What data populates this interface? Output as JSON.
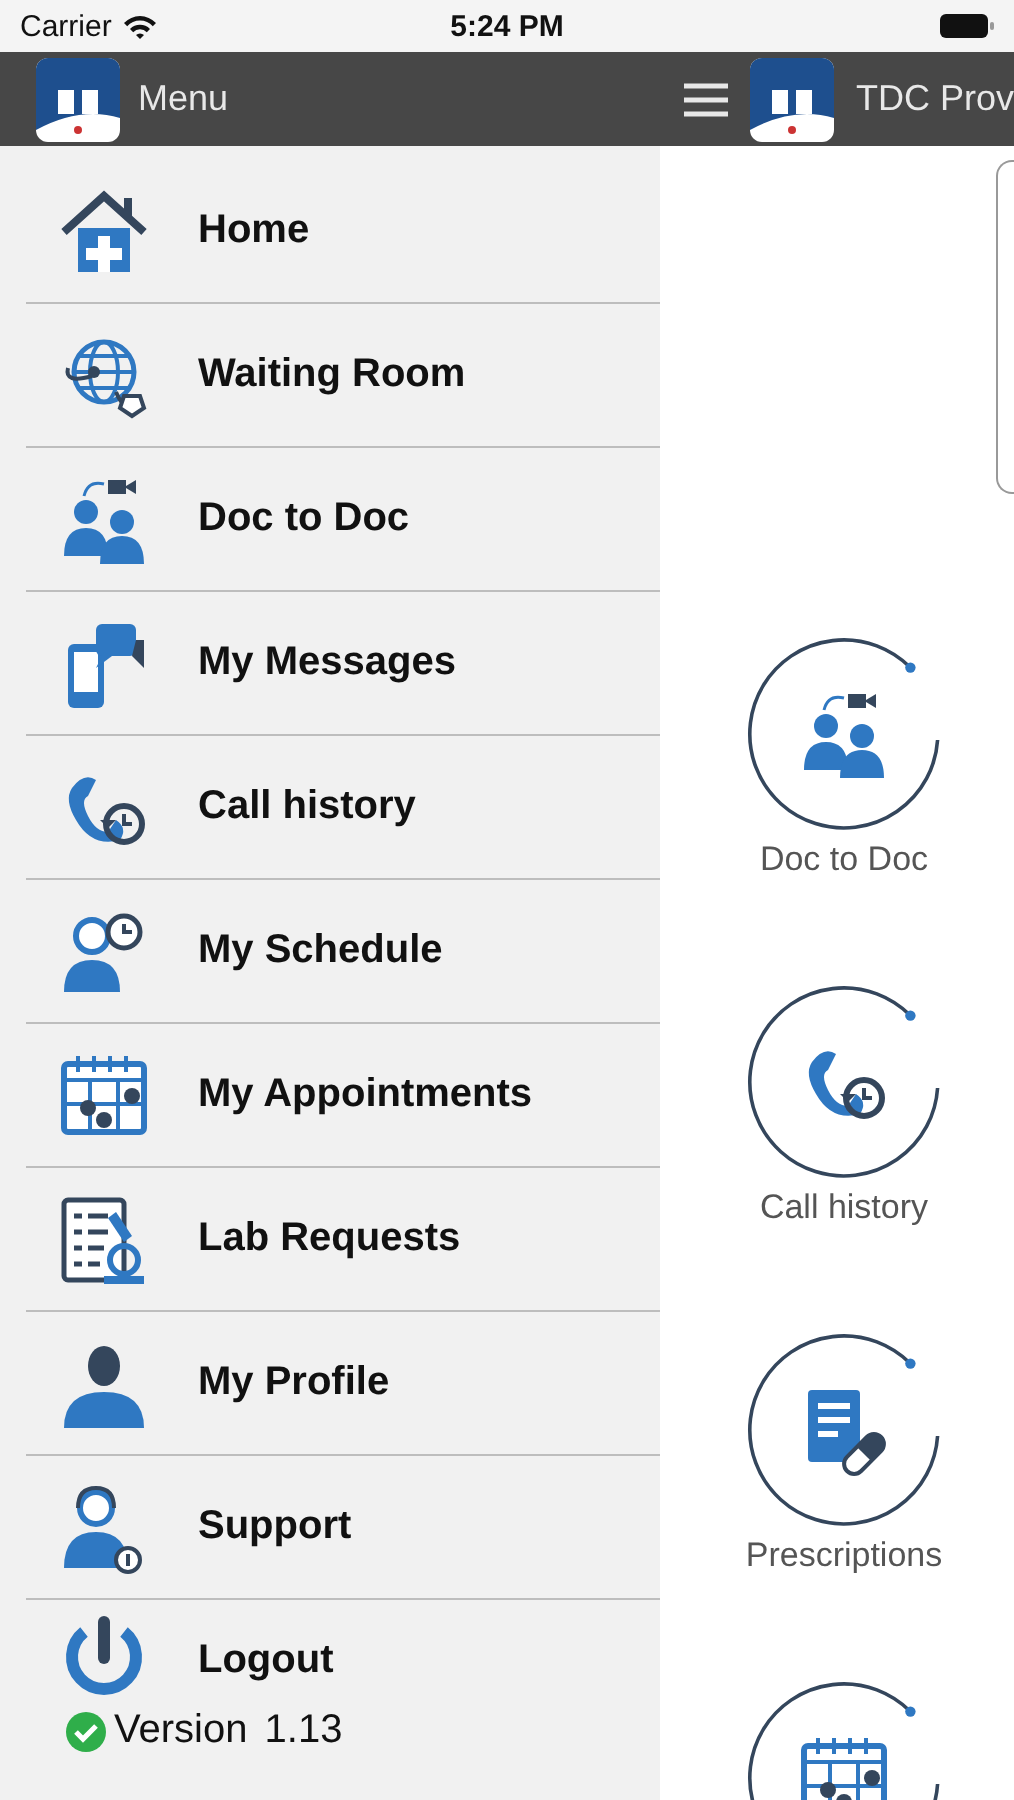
{
  "status_bar": {
    "carrier": "Carrier",
    "time": "5:24 PM"
  },
  "menu_header": {
    "title": "Menu"
  },
  "app_bar": {
    "title": "TDC Prov"
  },
  "menu_items": [
    {
      "label": "Home",
      "kind": "home"
    },
    {
      "label": "Waiting Room",
      "kind": "globe"
    },
    {
      "label": "Doc to Doc",
      "kind": "doctors"
    },
    {
      "label": "My Messages",
      "kind": "messages"
    },
    {
      "label": "Call history",
      "kind": "call"
    },
    {
      "label": "My Schedule",
      "kind": "schedule"
    },
    {
      "label": "My Appointments",
      "kind": "calendar"
    },
    {
      "label": "Lab Requests",
      "kind": "lab"
    },
    {
      "label": "My Profile",
      "kind": "profile"
    },
    {
      "label": "Support",
      "kind": "support"
    },
    {
      "label": "Logout",
      "kind": "power"
    }
  ],
  "version": {
    "label": "Version",
    "number": "1.13"
  },
  "tiles": [
    {
      "label": "Doc to Doc",
      "kind": "doctors"
    },
    {
      "label": "Call history",
      "kind": "call"
    },
    {
      "label": "Prescriptions",
      "kind": "prescription"
    },
    {
      "kind": "calendar"
    }
  ]
}
